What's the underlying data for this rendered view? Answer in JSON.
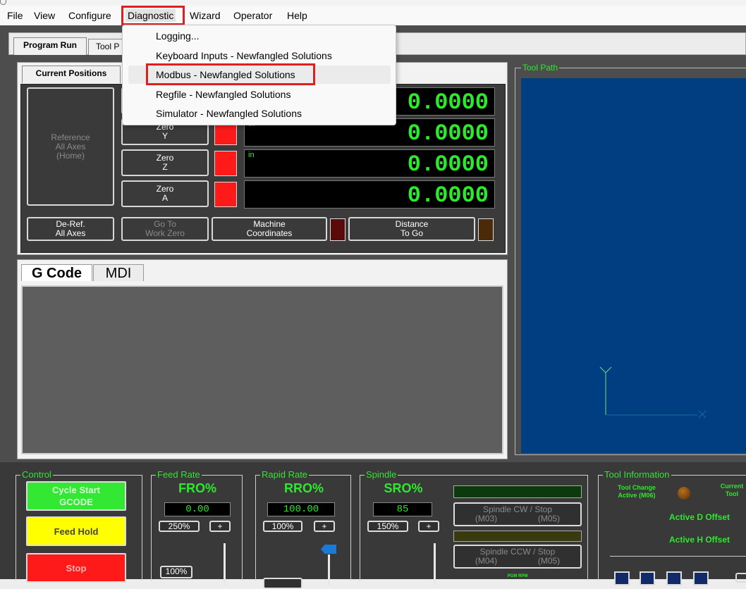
{
  "menu": {
    "items": [
      "File",
      "View",
      "Configure",
      "Diagnostic",
      "Wizard",
      "Operator",
      "Help"
    ],
    "active": "Diagnostic"
  },
  "dropdown": {
    "items": [
      "Logging...",
      "Keyboard Inputs - Newfangled Solutions",
      "Modbus - Newfangled Solutions",
      "Regfile - Newfangled Solutions",
      "Simulator - Newfangled Solutions"
    ],
    "highlighted": "Modbus - Newfangled Solutions"
  },
  "main_tabs": {
    "program_run": "Program Run",
    "tool_p": "Tool P"
  },
  "positions": {
    "tab": "Current Positions",
    "ref_all_line1": "Reference",
    "ref_all_line2": "All Axes",
    "ref_all_line3": "(Home)",
    "zero_label": "Zero",
    "axes": [
      "Y",
      "Z",
      "A"
    ],
    "unit": "in",
    "values": [
      "0.0000",
      "0.0000",
      "0.0000",
      "0.0000"
    ],
    "deref_line1": "De-Ref.",
    "deref_line2": "All Axes",
    "goto_line1": "Go To",
    "goto_line2": "Work Zero",
    "machine_line1": "Machine",
    "machine_line2": "Coordinates",
    "dtg_line1": "Distance",
    "dtg_line2": "To Go"
  },
  "gcode": {
    "tab_gcode": "G Code",
    "tab_mdi": "MDI"
  },
  "toolpath": {
    "title": "Tool Path"
  },
  "control": {
    "title": "Control",
    "cycle_start_line1": "Cycle Start",
    "cycle_start_line2": "GCODE",
    "feed_hold": "Feed Hold",
    "stop": "Stop"
  },
  "feed": {
    "title": "Feed Rate",
    "label": "FRO%",
    "value": "0.00",
    "btn_250": "250%",
    "btn_plus": "+",
    "btn_100": "100%"
  },
  "rapid": {
    "title": "Rapid Rate",
    "label": "RRO%",
    "value": "100.00",
    "btn_100": "100%",
    "btn_plus": "+"
  },
  "spindle": {
    "title": "Spindle",
    "label": "SRO%",
    "value": "85",
    "btn_150": "150%",
    "btn_plus": "+",
    "cw_line1": "Spindle CW / Stop",
    "cw_m03": "(M03)",
    "cw_m05": "(M05)",
    "ccw_line1": "Spindle CCW / Stop",
    "ccw_m04": "(M04)",
    "ccw_m05": "(M05)",
    "rpm_label": "PGM RPM"
  },
  "tool_info": {
    "title": "Tool Information",
    "tool_change_line1": "Tool Change",
    "tool_change_line2": "Active (M06)",
    "current_tool_line1": "Current",
    "current_tool_line2": "Tool",
    "active_d": "Active D Offset",
    "active_h": "Active H Offset"
  },
  "colors": {
    "dro_green": "#2ee82e",
    "toolpath_bg": "#003e82",
    "highlight_red": "#e02020",
    "cycle_start": "#33e833",
    "feed_hold": "#ffff00",
    "stop": "#ff1a1a"
  }
}
